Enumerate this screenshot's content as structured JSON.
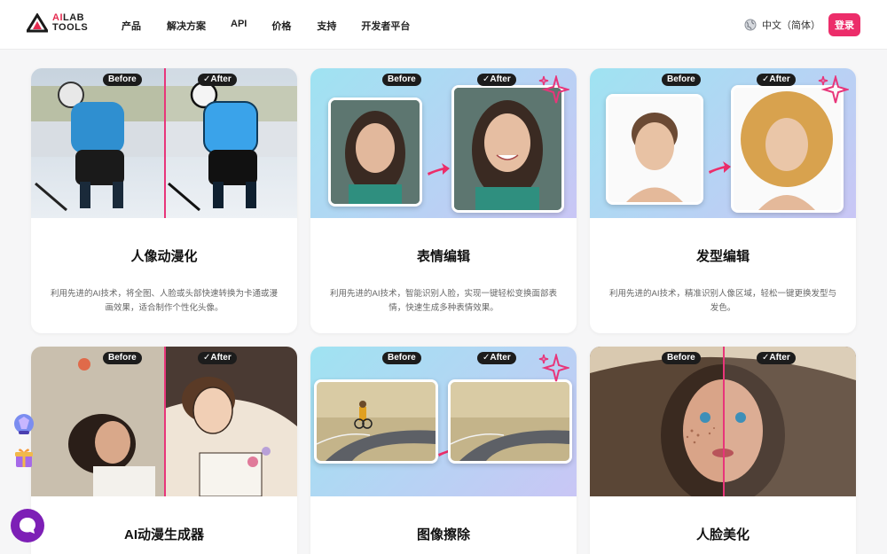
{
  "brand": {
    "line1_ai": "AI",
    "line1_rest": "LAB",
    "line2": "TOOLS",
    "accent": "#e52b50",
    "dark": "#1a1a1a"
  },
  "nav": {
    "items": [
      "产品",
      "解决方案",
      "API",
      "价格",
      "支持",
      "开发者平台"
    ]
  },
  "header": {
    "language": "中文（简体）",
    "language_icon": "globe-icon",
    "login": "登录",
    "login_color": "#ec2d6a"
  },
  "badges": {
    "before": "Before",
    "after": "✓After"
  },
  "cards": [
    {
      "title": "人像动漫化",
      "desc": "利用先进的AI技术，将全图、人脸或头部快速转换为卡通或漫画效果，适合制作个性化头像。"
    },
    {
      "title": "表情编辑",
      "desc": "利用先进的AI技术，智能识别人脸，实现一键轻松变换面部表情，快速生成多种表情效果。"
    },
    {
      "title": "发型编辑",
      "desc": "利用先进的AI技术，精准识别人像区域，轻松一键更换发型与发色。"
    },
    {
      "title": "AI动漫生成器",
      "desc": ""
    },
    {
      "title": "图像擦除",
      "desc": ""
    },
    {
      "title": "人脸美化",
      "desc": ""
    }
  ],
  "floating": {
    "icons": [
      "crystal-ball-icon",
      "gift-icon",
      "chat-icon"
    ]
  }
}
